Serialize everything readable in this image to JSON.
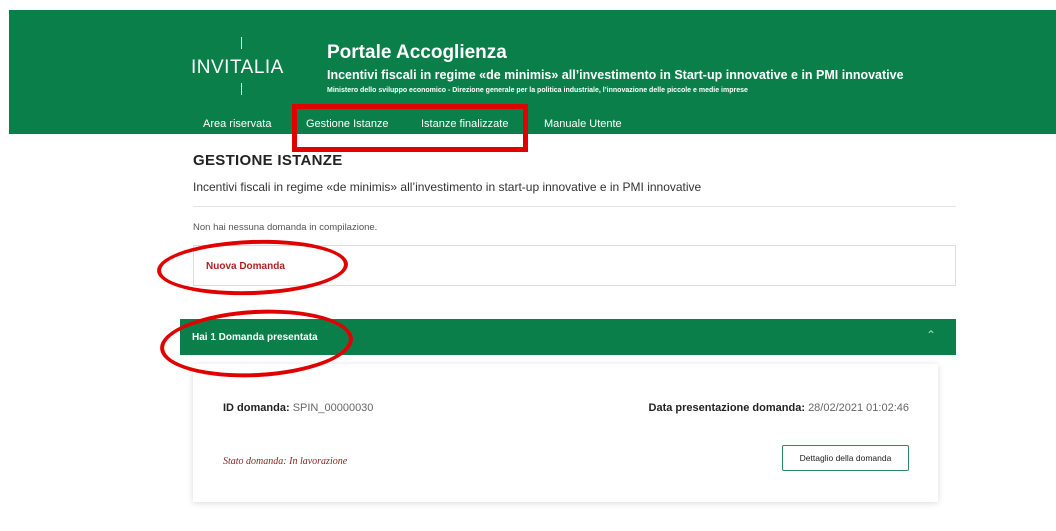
{
  "header": {
    "logo_text": "INVITALIA",
    "title": "Portale Accoglienza",
    "subtitle": "Incentivi fiscali in regime «de minimis» all’investimento in Start-up innovative e in PMI innovative",
    "ministry": "Ministero dello sviluppo economico - Direzione generale per la politica industriale, l’innovazione delle piccole e medie imprese"
  },
  "nav": {
    "items": [
      {
        "label": "Area riservata"
      },
      {
        "label": "Gestione Istanze"
      },
      {
        "label": "Istanze finalizzate"
      },
      {
        "label": "Manuale Utente"
      }
    ]
  },
  "main": {
    "title": "GESTIONE ISTANZE",
    "subtitle": "Incentivi fiscali in regime «de minimis» all’investimento in start-up innovative e in PMI innovative",
    "no_draft_text": "Non hai nessuna domanda in compilazione.",
    "new_application_label": "Nuova Domanda",
    "submitted_header": "Hai 1 Domanda presentata",
    "chevron_icon": "chevron-up-icon"
  },
  "application": {
    "id_label": "ID domanda:",
    "id_value": "SPIN_00000030",
    "date_label": "Data presentazione domanda:",
    "date_value": "28/02/2021 01:02:46",
    "status_text": "Stato domanda: In lavorazione",
    "detail_button_label": "Dettaglio della domanda"
  },
  "colors": {
    "brand_green": "#0b7f4a",
    "annotation_red": "#e00000",
    "link_red": "#b32020"
  }
}
